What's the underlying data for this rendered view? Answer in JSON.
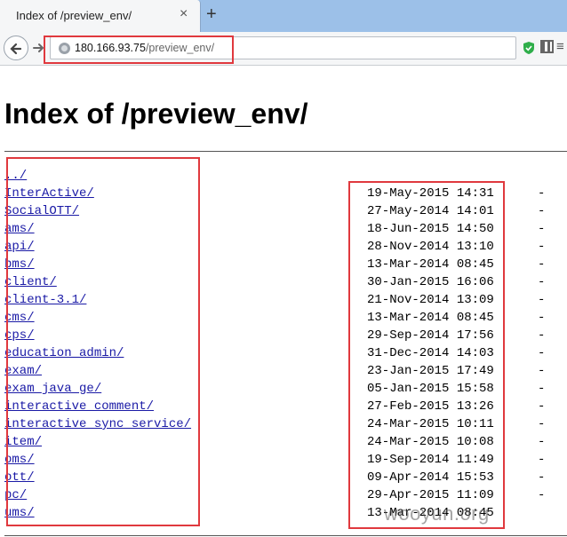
{
  "browser": {
    "tab_title": "Index of /preview_env/",
    "tab_close": "×",
    "new_tab": "+",
    "url_host": "180.166.93.75",
    "url_path": "/preview_env/",
    "menu_glyph": "≡"
  },
  "page": {
    "title": "Index of /preview_env/",
    "entries": [
      {
        "name": "../",
        "date": "",
        "size": ""
      },
      {
        "name": "InterActive/",
        "date": "19-May-2015 14:31",
        "size": "-"
      },
      {
        "name": "SocialOTT/",
        "date": "27-May-2014 14:01",
        "size": "-"
      },
      {
        "name": "ams/",
        "date": "18-Jun-2015 14:50",
        "size": "-"
      },
      {
        "name": "api/",
        "date": "28-Nov-2014 13:10",
        "size": "-"
      },
      {
        "name": "bms/",
        "date": "13-Mar-2014 08:45",
        "size": "-"
      },
      {
        "name": "client/",
        "date": "30-Jan-2015 16:06",
        "size": "-"
      },
      {
        "name": "client-3.1/",
        "date": "21-Nov-2014 13:09",
        "size": "-"
      },
      {
        "name": "cms/",
        "date": "13-Mar-2014 08:45",
        "size": "-"
      },
      {
        "name": "cps/",
        "date": "29-Sep-2014 17:56",
        "size": "-"
      },
      {
        "name": "education_admin/",
        "date": "31-Dec-2014 14:03",
        "size": "-"
      },
      {
        "name": "exam/",
        "date": "23-Jan-2015 17:49",
        "size": "-"
      },
      {
        "name": "exam_java_ge/",
        "date": "05-Jan-2015 15:58",
        "size": "-"
      },
      {
        "name": "interactive_comment/",
        "date": "27-Feb-2015 13:26",
        "size": "-"
      },
      {
        "name": "interactive_sync_service/",
        "date": "24-Mar-2015 10:11",
        "size": "-"
      },
      {
        "name": "item/",
        "date": "24-Mar-2015 10:08",
        "size": "-"
      },
      {
        "name": "oms/",
        "date": "19-Sep-2014 11:49",
        "size": "-"
      },
      {
        "name": "ott/",
        "date": "09-Apr-2014 15:53",
        "size": "-"
      },
      {
        "name": "pc/",
        "date": "29-Apr-2015 11:09",
        "size": "-"
      },
      {
        "name": "ums/",
        "date": "13-Mar-2014 08:45",
        "size": ""
      }
    ]
  },
  "watermark": "wooyun.org",
  "colors": {
    "annotation": "#e0393e",
    "link": "#1a1aa6"
  }
}
